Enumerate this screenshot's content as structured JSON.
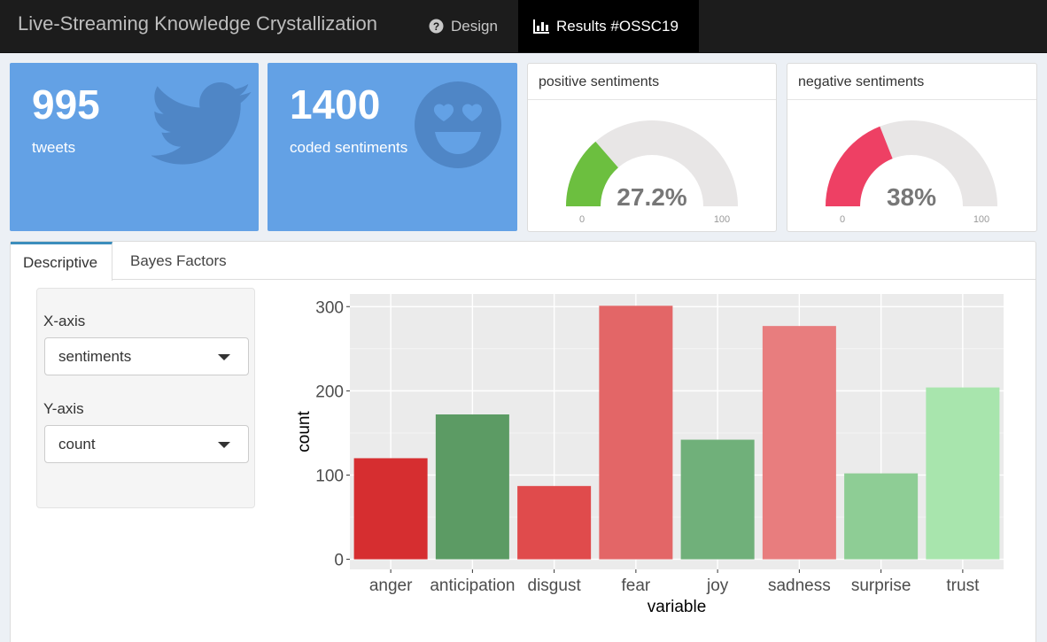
{
  "navbar": {
    "title": "Live-Streaming Knowledge Crystallization",
    "tabs": [
      {
        "label": "Design",
        "icon": "question-circle-icon"
      },
      {
        "label": "Results #OSSC19",
        "icon": "bar-chart-icon"
      }
    ]
  },
  "value_boxes": [
    {
      "value": "995",
      "label": "tweets",
      "icon": "twitter-icon",
      "color": "#63a1e5"
    },
    {
      "value": "1400",
      "label": "coded sentiments",
      "icon": "heart-eyes-icon",
      "color": "#63a1e5"
    }
  ],
  "gauges": [
    {
      "title": "positive sentiments",
      "value": 27.2,
      "display": "27.2%",
      "min": "0",
      "max": "100",
      "color": "#6cbf3f"
    },
    {
      "title": "negative sentiments",
      "value": 38,
      "display": "38%",
      "min": "0",
      "max": "100",
      "color": "#ee4064"
    }
  ],
  "panel": {
    "tabs": [
      {
        "label": "Descriptive",
        "active": true
      },
      {
        "label": "Bayes Factors",
        "active": false
      }
    ],
    "sidebar": {
      "x_label": "X-axis",
      "x_value": "sentiments",
      "y_label": "Y-axis",
      "y_value": "count"
    }
  },
  "chart_data": {
    "type": "bar",
    "categories": [
      "anger",
      "anticipation",
      "disgust",
      "fear",
      "joy",
      "sadness",
      "surprise",
      "trust"
    ],
    "values": [
      120,
      172,
      87,
      301,
      142,
      277,
      102,
      204
    ],
    "colors": [
      "#d62e30",
      "#5c9b64",
      "#e04b4c",
      "#e36667",
      "#70b07a",
      "#e87d7e",
      "#8ecd95",
      "#a8e5ad"
    ],
    "xlabel": "variable",
    "ylabel": "count",
    "yticks": [
      0,
      100,
      200,
      300
    ],
    "ylim": [
      -12,
      315
    ],
    "grid": true
  }
}
